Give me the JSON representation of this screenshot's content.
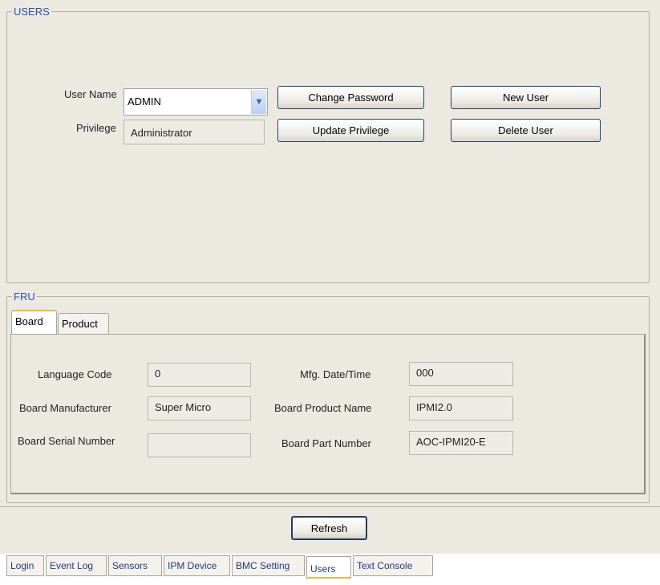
{
  "users": {
    "legend": "USERS",
    "user_name_label": "User Name",
    "user_name_value": "ADMIN",
    "privilege_label": "Privilege",
    "privilege_value": "Administrator",
    "buttons": {
      "change_password": "Change Password",
      "new_user": "New User",
      "update_privilege": "Update Privilege",
      "delete_user": "Delete User"
    }
  },
  "fru": {
    "legend": "FRU",
    "tabs": [
      "Board",
      "Product"
    ],
    "active_tab": "Board",
    "fields": {
      "language_code": {
        "label": "Language Code",
        "value": "0"
      },
      "board_manufacturer": {
        "label": "Board Manufacturer",
        "value": "Super Micro"
      },
      "board_serial_number": {
        "label": "Board Serial Number",
        "value": ""
      },
      "mfg_date_time": {
        "label": "Mfg. Date/Time",
        "value": "000"
      },
      "board_product_name": {
        "label": "Board Product Name",
        "value": "IPMI2.0"
      },
      "board_part_number": {
        "label": "Board Part Number",
        "value": "AOC-IPMI20-E"
      }
    }
  },
  "refresh_label": "Refresh",
  "bottom_tabs": [
    "Login",
    "Event Log",
    "Sensors",
    "IPM Device",
    "BMC Setting",
    "Users",
    "Text Console"
  ],
  "active_bottom_tab": "Users",
  "colors": {
    "legend_text": "#2a4fb8",
    "panel_bg": "#eceae0",
    "active_tab_accent": "#f0b64a"
  }
}
